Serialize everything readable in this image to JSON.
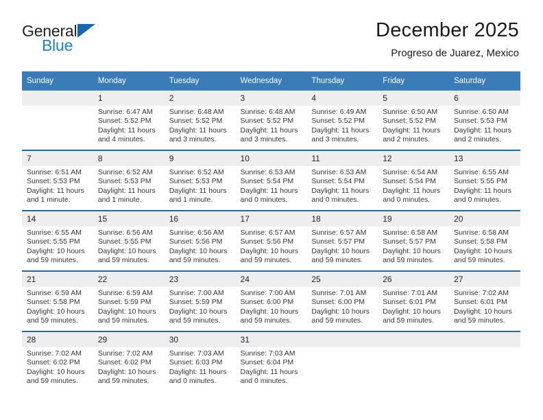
{
  "brand": {
    "name_top": "General",
    "name_bottom": "Blue",
    "triangle_color": "#1667b2",
    "blue_text_color": "#1f7fd4"
  },
  "header": {
    "title": "December 2025",
    "location": "Progreso de Juarez, Mexico"
  },
  "theme": {
    "header_bg": "#3a7cb8",
    "row_divider": "#1d6cad",
    "daynum_bg": "#eeeeee"
  },
  "weekday_headers": [
    "Sunday",
    "Monday",
    "Tuesday",
    "Wednesday",
    "Thursday",
    "Friday",
    "Saturday"
  ],
  "weeks": [
    [
      {
        "day": "",
        "sunrise": "",
        "sunset": "",
        "daylight_1": "",
        "daylight_2": ""
      },
      {
        "day": "1",
        "sunrise": "Sunrise: 6:47 AM",
        "sunset": "Sunset: 5:52 PM",
        "daylight_1": "Daylight: 11 hours",
        "daylight_2": "and 4 minutes."
      },
      {
        "day": "2",
        "sunrise": "Sunrise: 6:48 AM",
        "sunset": "Sunset: 5:52 PM",
        "daylight_1": "Daylight: 11 hours",
        "daylight_2": "and 3 minutes."
      },
      {
        "day": "3",
        "sunrise": "Sunrise: 6:48 AM",
        "sunset": "Sunset: 5:52 PM",
        "daylight_1": "Daylight: 11 hours",
        "daylight_2": "and 3 minutes."
      },
      {
        "day": "4",
        "sunrise": "Sunrise: 6:49 AM",
        "sunset": "Sunset: 5:52 PM",
        "daylight_1": "Daylight: 11 hours",
        "daylight_2": "and 3 minutes."
      },
      {
        "day": "5",
        "sunrise": "Sunrise: 6:50 AM",
        "sunset": "Sunset: 5:52 PM",
        "daylight_1": "Daylight: 11 hours",
        "daylight_2": "and 2 minutes."
      },
      {
        "day": "6",
        "sunrise": "Sunrise: 6:50 AM",
        "sunset": "Sunset: 5:53 PM",
        "daylight_1": "Daylight: 11 hours",
        "daylight_2": "and 2 minutes."
      }
    ],
    [
      {
        "day": "7",
        "sunrise": "Sunrise: 6:51 AM",
        "sunset": "Sunset: 5:53 PM",
        "daylight_1": "Daylight: 11 hours",
        "daylight_2": "and 1 minute."
      },
      {
        "day": "8",
        "sunrise": "Sunrise: 6:52 AM",
        "sunset": "Sunset: 5:53 PM",
        "daylight_1": "Daylight: 11 hours",
        "daylight_2": "and 1 minute."
      },
      {
        "day": "9",
        "sunrise": "Sunrise: 6:52 AM",
        "sunset": "Sunset: 5:53 PM",
        "daylight_1": "Daylight: 11 hours",
        "daylight_2": "and 1 minute."
      },
      {
        "day": "10",
        "sunrise": "Sunrise: 6:53 AM",
        "sunset": "Sunset: 5:54 PM",
        "daylight_1": "Daylight: 11 hours",
        "daylight_2": "and 0 minutes."
      },
      {
        "day": "11",
        "sunrise": "Sunrise: 6:53 AM",
        "sunset": "Sunset: 5:54 PM",
        "daylight_1": "Daylight: 11 hours",
        "daylight_2": "and 0 minutes."
      },
      {
        "day": "12",
        "sunrise": "Sunrise: 6:54 AM",
        "sunset": "Sunset: 5:54 PM",
        "daylight_1": "Daylight: 11 hours",
        "daylight_2": "and 0 minutes."
      },
      {
        "day": "13",
        "sunrise": "Sunrise: 6:55 AM",
        "sunset": "Sunset: 5:55 PM",
        "daylight_1": "Daylight: 11 hours",
        "daylight_2": "and 0 minutes."
      }
    ],
    [
      {
        "day": "14",
        "sunrise": "Sunrise: 6:55 AM",
        "sunset": "Sunset: 5:55 PM",
        "daylight_1": "Daylight: 10 hours",
        "daylight_2": "and 59 minutes."
      },
      {
        "day": "15",
        "sunrise": "Sunrise: 6:56 AM",
        "sunset": "Sunset: 5:55 PM",
        "daylight_1": "Daylight: 10 hours",
        "daylight_2": "and 59 minutes."
      },
      {
        "day": "16",
        "sunrise": "Sunrise: 6:56 AM",
        "sunset": "Sunset: 5:56 PM",
        "daylight_1": "Daylight: 10 hours",
        "daylight_2": "and 59 minutes."
      },
      {
        "day": "17",
        "sunrise": "Sunrise: 6:57 AM",
        "sunset": "Sunset: 5:56 PM",
        "daylight_1": "Daylight: 10 hours",
        "daylight_2": "and 59 minutes."
      },
      {
        "day": "18",
        "sunrise": "Sunrise: 6:57 AM",
        "sunset": "Sunset: 5:57 PM",
        "daylight_1": "Daylight: 10 hours",
        "daylight_2": "and 59 minutes."
      },
      {
        "day": "19",
        "sunrise": "Sunrise: 6:58 AM",
        "sunset": "Sunset: 5:57 PM",
        "daylight_1": "Daylight: 10 hours",
        "daylight_2": "and 59 minutes."
      },
      {
        "day": "20",
        "sunrise": "Sunrise: 6:58 AM",
        "sunset": "Sunset: 5:58 PM",
        "daylight_1": "Daylight: 10 hours",
        "daylight_2": "and 59 minutes."
      }
    ],
    [
      {
        "day": "21",
        "sunrise": "Sunrise: 6:59 AM",
        "sunset": "Sunset: 5:58 PM",
        "daylight_1": "Daylight: 10 hours",
        "daylight_2": "and 59 minutes."
      },
      {
        "day": "22",
        "sunrise": "Sunrise: 6:59 AM",
        "sunset": "Sunset: 5:59 PM",
        "daylight_1": "Daylight: 10 hours",
        "daylight_2": "and 59 minutes."
      },
      {
        "day": "23",
        "sunrise": "Sunrise: 7:00 AM",
        "sunset": "Sunset: 5:59 PM",
        "daylight_1": "Daylight: 10 hours",
        "daylight_2": "and 59 minutes."
      },
      {
        "day": "24",
        "sunrise": "Sunrise: 7:00 AM",
        "sunset": "Sunset: 6:00 PM",
        "daylight_1": "Daylight: 10 hours",
        "daylight_2": "and 59 minutes."
      },
      {
        "day": "25",
        "sunrise": "Sunrise: 7:01 AM",
        "sunset": "Sunset: 6:00 PM",
        "daylight_1": "Daylight: 10 hours",
        "daylight_2": "and 59 minutes."
      },
      {
        "day": "26",
        "sunrise": "Sunrise: 7:01 AM",
        "sunset": "Sunset: 6:01 PM",
        "daylight_1": "Daylight: 10 hours",
        "daylight_2": "and 59 minutes."
      },
      {
        "day": "27",
        "sunrise": "Sunrise: 7:02 AM",
        "sunset": "Sunset: 6:01 PM",
        "daylight_1": "Daylight: 10 hours",
        "daylight_2": "and 59 minutes."
      }
    ],
    [
      {
        "day": "28",
        "sunrise": "Sunrise: 7:02 AM",
        "sunset": "Sunset: 6:02 PM",
        "daylight_1": "Daylight: 10 hours",
        "daylight_2": "and 59 minutes."
      },
      {
        "day": "29",
        "sunrise": "Sunrise: 7:02 AM",
        "sunset": "Sunset: 6:02 PM",
        "daylight_1": "Daylight: 10 hours",
        "daylight_2": "and 59 minutes."
      },
      {
        "day": "30",
        "sunrise": "Sunrise: 7:03 AM",
        "sunset": "Sunset: 6:03 PM",
        "daylight_1": "Daylight: 11 hours",
        "daylight_2": "and 0 minutes."
      },
      {
        "day": "31",
        "sunrise": "Sunrise: 7:03 AM",
        "sunset": "Sunset: 6:04 PM",
        "daylight_1": "Daylight: 11 hours",
        "daylight_2": "and 0 minutes."
      },
      {
        "day": "",
        "sunrise": "",
        "sunset": "",
        "daylight_1": "",
        "daylight_2": ""
      },
      {
        "day": "",
        "sunrise": "",
        "sunset": "",
        "daylight_1": "",
        "daylight_2": ""
      },
      {
        "day": "",
        "sunrise": "",
        "sunset": "",
        "daylight_1": "",
        "daylight_2": ""
      }
    ]
  ]
}
